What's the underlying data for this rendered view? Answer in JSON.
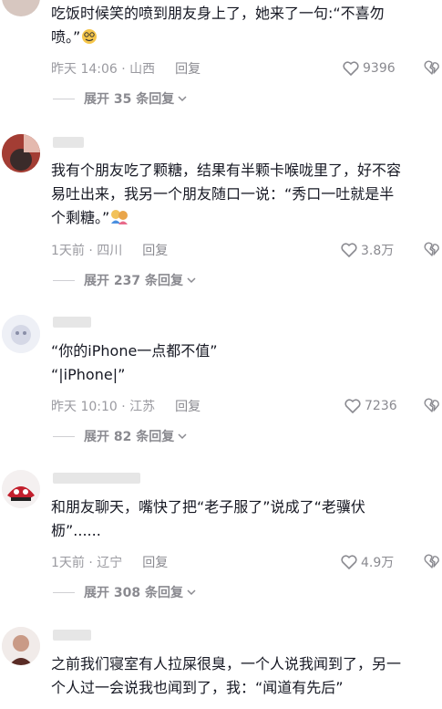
{
  "comments": [
    {
      "text_lines": [
        "吃饭时候笑的喷到朋友身上了，她来了一句:“不喜勿",
        "喷。”"
      ],
      "time": "昨天 14:06 · 山西",
      "reply": "回复",
      "likes": "9396",
      "expand": "展开 35 条回复"
    },
    {
      "text_lines": [
        "我有个朋友吃了颗糖，结果有半颗卡喉咙里了，好不容",
        "易吐出来，我另一个朋友随口一说：“秀口一吐就是半",
        "个剩糖。”"
      ],
      "time": "1天前 · 四川",
      "reply": "回复",
      "likes": "3.8万",
      "expand": "展开 237 条回复"
    },
    {
      "text_lines": [
        "“你的iPhone一点都不值”",
        "“|iPhone|”"
      ],
      "time": "昨天 10:10 · 江苏",
      "reply": "回复",
      "likes": "7236",
      "expand": "展开 82 条回复"
    },
    {
      "text_lines": [
        "和朋友聊天，嘴快了把“老子服了”说成了“老骥伏",
        "枥”......"
      ],
      "time": "1天前 · 辽宁",
      "reply": "回复",
      "likes": "4.9万",
      "expand": "展开 308 条回复"
    },
    {
      "text_lines": [
        "之前我们寝室有人拉屎很臭，一个人说我闻到了，另一",
        "个人过一会说我也闻到了，我：“闻道有先后”"
      ]
    }
  ],
  "icons": {
    "like": "heart-outline-icon",
    "dislike": "broken-heart-icon",
    "expand_chevron": "chevron-down-icon"
  },
  "colors": {
    "meta_gray": "#9a9aa0",
    "text": "#161823"
  }
}
